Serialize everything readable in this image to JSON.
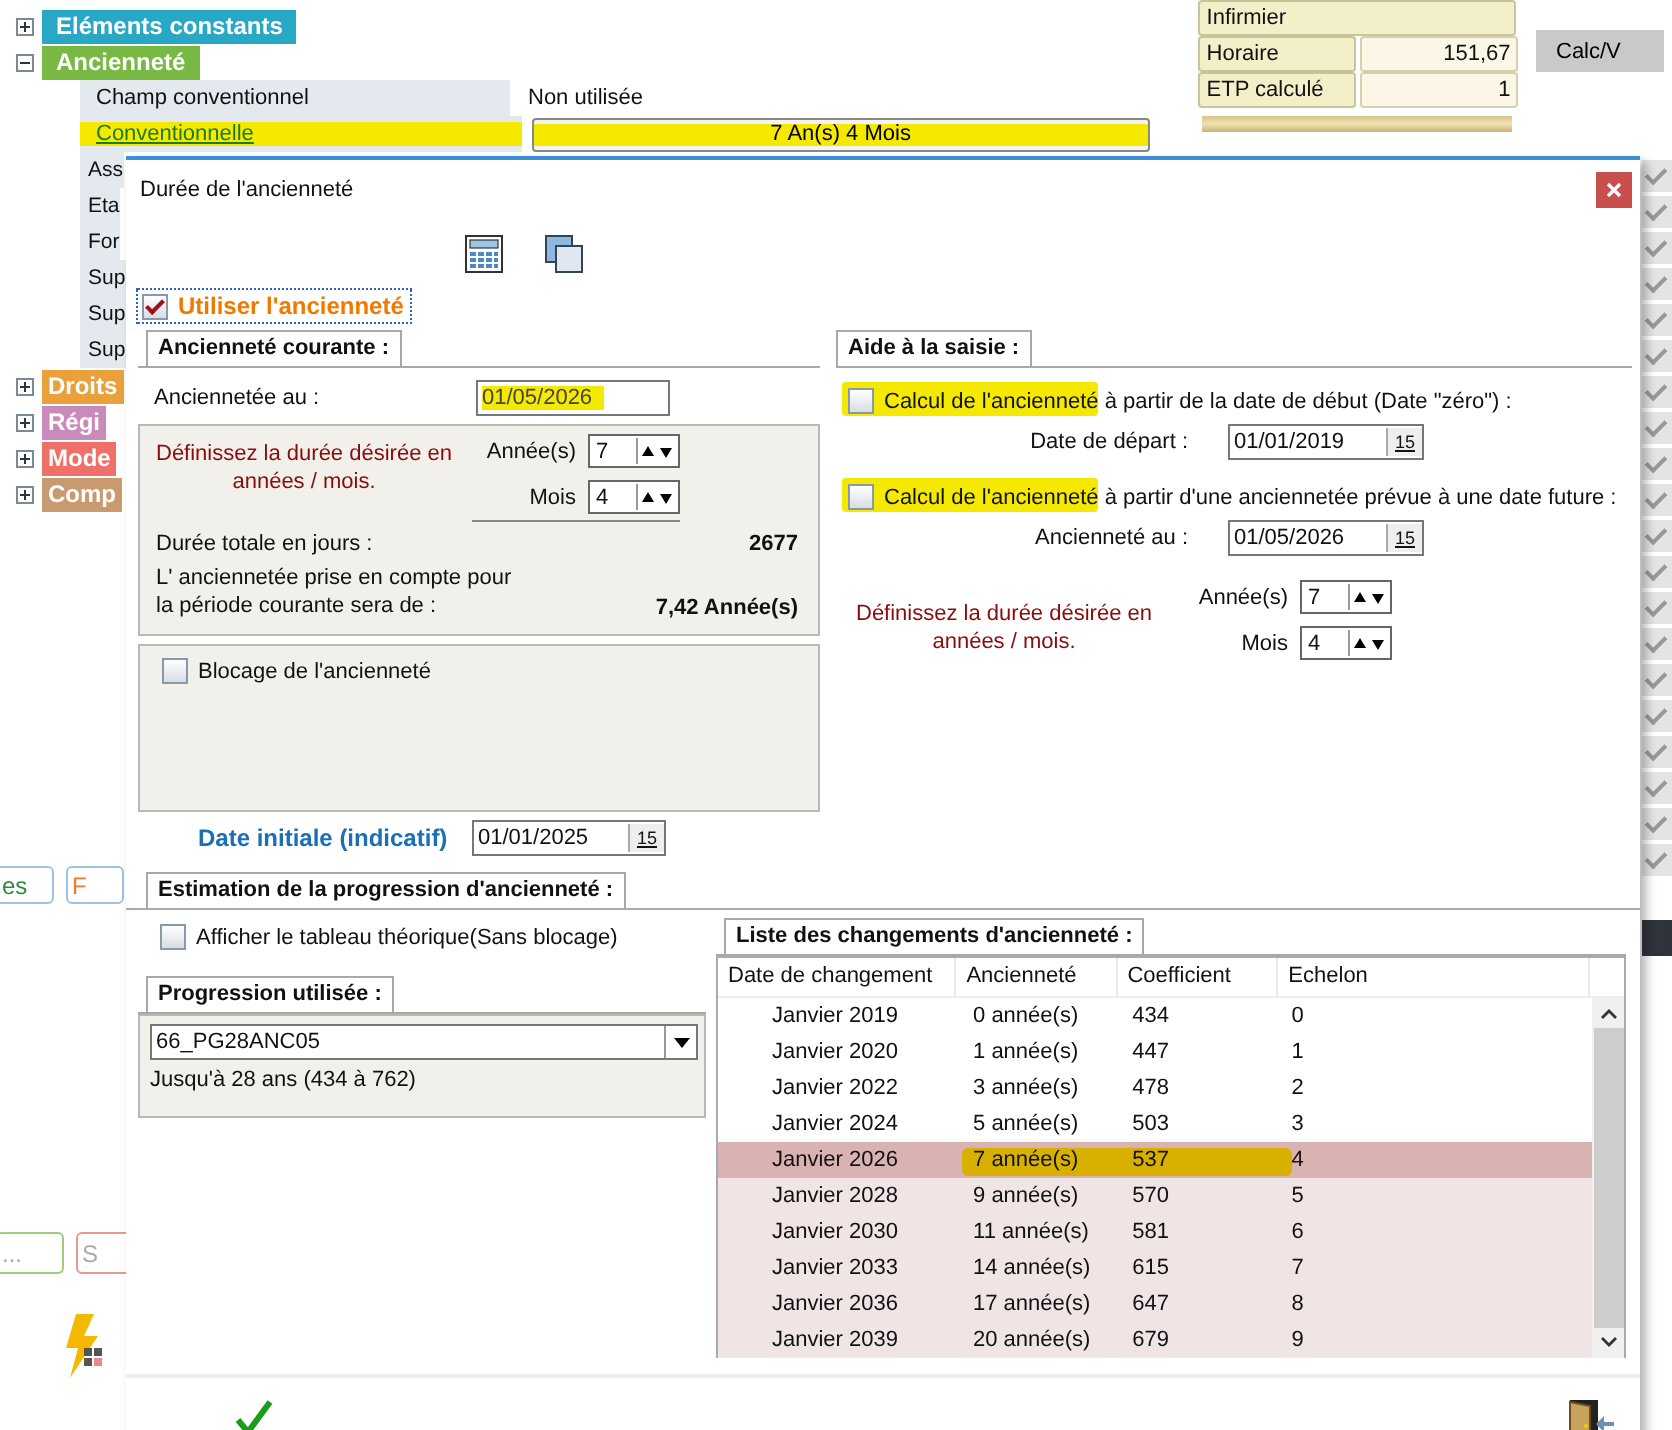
{
  "background": {
    "tree": [
      {
        "label": "Eléments constants",
        "color": "#29a8c6",
        "expanded": false
      },
      {
        "label": "Ancienneté",
        "color": "#78b944",
        "expanded": true
      }
    ],
    "properties": [
      {
        "label": "Champ conventionnel",
        "value": "Non utilisée",
        "kind": "text",
        "highlighted": false
      },
      {
        "label": "Conventionnelle",
        "value": "7 An(s) 4 Mois",
        "kind": "button",
        "highlighted": true
      }
    ],
    "cut_labels": [
      "Ass",
      "Eta",
      "For",
      "Sup",
      "Sup",
      "Sup"
    ],
    "more_tree": [
      {
        "label": "Droits",
        "color": "#eaa13c",
        "expanded": false
      },
      {
        "label": "Régi",
        "color": "#c98bb9",
        "expanded": false
      },
      {
        "label": "Mode",
        "color": "#ef7068",
        "expanded": false
      },
      {
        "label": "Comp",
        "color": "#c99a70",
        "expanded": false
      }
    ],
    "tab_buttons": [
      {
        "label": "es",
        "color": "#2e8b3e"
      },
      {
        "label": "F",
        "color": "#f37a2b"
      }
    ],
    "action_buttons": [
      {
        "label": "...",
        "color": "#9ccd7a"
      },
      {
        "label": "S",
        "color": "#e79a90"
      }
    ],
    "info": [
      {
        "label": "Infirmier"
      },
      {
        "label": "Horaire",
        "value": "151,67"
      },
      {
        "label": "ETP calculé",
        "value": "1"
      }
    ],
    "calc_button": "Calc/V",
    "side_checks": [
      {
        "checked": true
      },
      {
        "checked": true
      },
      {
        "checked": true
      },
      {
        "checked": true
      },
      {
        "checked": true
      },
      {
        "checked": true
      },
      {
        "checked": true
      },
      {
        "checked": true
      },
      {
        "checked": true
      },
      {
        "checked": true
      },
      {
        "checked": true
      },
      {
        "checked": true
      },
      {
        "checked": true
      },
      {
        "checked": true
      },
      {
        "checked": true
      },
      {
        "checked": true
      },
      {
        "checked": true
      },
      {
        "checked": true
      },
      {
        "checked": true
      },
      {
        "checked": true
      }
    ]
  },
  "dialog": {
    "title": "Durée de l'ancienneté",
    "use_seniority": {
      "label": "Utiliser l'ancienneté",
      "checked": true
    },
    "current": {
      "tab": "Ancienneté courante :",
      "date_label": "Anciennetée au :",
      "date": "01/05/2026",
      "date_highlighted": true,
      "hint": "Définissez la durée désirée en années / mois.",
      "years_label": "Année(s)",
      "years": "7",
      "months_label": "Mois",
      "months": "4",
      "total_label": "Durée totale en jours :",
      "total": "2677",
      "taken_label": "L' anciennetée prise en compte pour la période courante sera de :",
      "taken": "7,42 Année(s)",
      "block": {
        "label": "Blocage de l'ancienneté",
        "checked": false
      },
      "initial_label": "Date initiale (indicatif)",
      "initial_date": "01/01/2025",
      "calendar_day": "15"
    },
    "helper": {
      "tab": "Aide à la saisie :",
      "options": [
        {
          "label": "Calcul de l'ancienneté à partir de la date de début (Date \"zéro\") :",
          "checked": false,
          "highlighted": true,
          "field_label": "Date de départ :",
          "date": "01/01/2019",
          "calendar_day": "15"
        },
        {
          "label": "Calcul de l'ancienneté à partir d'une anciennetée prévue à une date future :",
          "checked": false,
          "highlighted": true,
          "field_label": "Ancienneté au :",
          "date": "01/05/2026",
          "calendar_day": "15"
        }
      ],
      "hint": "Définissez la durée désirée en années / mois.",
      "years_label": "Année(s)",
      "years": "7",
      "months_label": "Mois",
      "months": "4"
    },
    "estimation": {
      "tab": "Estimation de la progression d'ancienneté :",
      "show_theory": {
        "label": "Afficher le tableau théorique(Sans blocage)",
        "checked": false
      },
      "progression_tab": "Progression utilisée :",
      "progression": "66_PG28ANC05",
      "progression_note": "Jusqu'à 28 ans (434 à 762)",
      "list_tab": "Liste des changements d'ancienneté :",
      "columns": [
        "Date de changement",
        "Ancienneté",
        "Coefficient",
        "Echelon"
      ],
      "rows": [
        {
          "cells": [
            "Janvier 2019",
            "0 année(s)",
            "434",
            "0"
          ],
          "selected": false,
          "future": false,
          "highlighted": false
        },
        {
          "cells": [
            "Janvier 2020",
            "1 année(s)",
            "447",
            "1"
          ],
          "selected": false,
          "future": false,
          "highlighted": false
        },
        {
          "cells": [
            "Janvier 2022",
            "3 année(s)",
            "478",
            "2"
          ],
          "selected": false,
          "future": false,
          "highlighted": false
        },
        {
          "cells": [
            "Janvier 2024",
            "5 année(s)",
            "503",
            "3"
          ],
          "selected": false,
          "future": false,
          "highlighted": false
        },
        {
          "cells": [
            "Janvier 2026",
            "7 année(s)",
            "537",
            "4"
          ],
          "selected": true,
          "future": false,
          "highlighted": true
        },
        {
          "cells": [
            "Janvier 2028",
            "9 année(s)",
            "570",
            "5"
          ],
          "selected": false,
          "future": true,
          "highlighted": false
        },
        {
          "cells": [
            "Janvier 2030",
            "11 année(s)",
            "581",
            "6"
          ],
          "selected": false,
          "future": true,
          "highlighted": false
        },
        {
          "cells": [
            "Janvier 2033",
            "14 année(s)",
            "615",
            "7"
          ],
          "selected": false,
          "future": true,
          "highlighted": false
        },
        {
          "cells": [
            "Janvier 2036",
            "17 année(s)",
            "647",
            "8"
          ],
          "selected": false,
          "future": true,
          "highlighted": false
        },
        {
          "cells": [
            "Janvier 2039",
            "20 année(s)",
            "679",
            "9"
          ],
          "selected": false,
          "future": true,
          "highlighted": false
        }
      ]
    }
  }
}
